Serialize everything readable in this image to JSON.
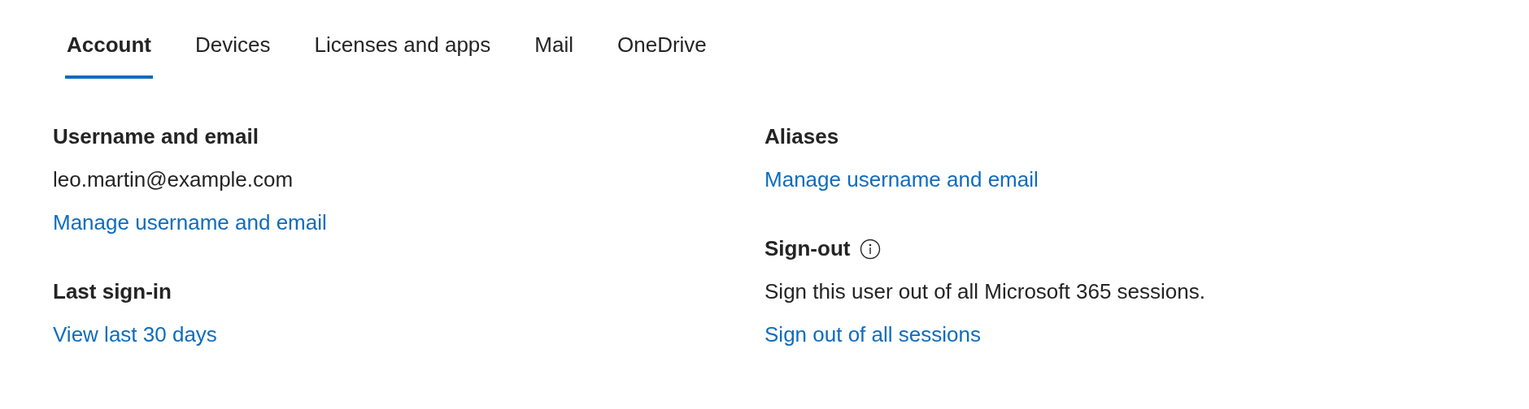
{
  "tabs": [
    {
      "label": "Account",
      "selected": true
    },
    {
      "label": "Devices",
      "selected": false
    },
    {
      "label": "Licenses and apps",
      "selected": false
    },
    {
      "label": "Mail",
      "selected": false
    },
    {
      "label": "OneDrive",
      "selected": false
    }
  ],
  "columns": [
    {
      "sections": [
        {
          "title": "Username and email",
          "info_icon": false,
          "lines": [
            {
              "kind": "text",
              "text": "leo.martin@example.com"
            },
            {
              "kind": "link",
              "text": "Manage username and email"
            }
          ]
        },
        {
          "title": "Last sign-in",
          "info_icon": false,
          "lines": [
            {
              "kind": "link",
              "text": "View last 30 days"
            }
          ]
        }
      ]
    },
    {
      "sections": [
        {
          "title": "Aliases",
          "info_icon": false,
          "lines": [
            {
              "kind": "link",
              "text": "Manage username and email"
            }
          ]
        },
        {
          "title": "Sign-out",
          "info_icon": true,
          "lines": [
            {
              "kind": "text",
              "text": "Sign this user out of all Microsoft 365 sessions."
            },
            {
              "kind": "link",
              "text": "Sign out of all sessions"
            }
          ]
        }
      ]
    }
  ]
}
